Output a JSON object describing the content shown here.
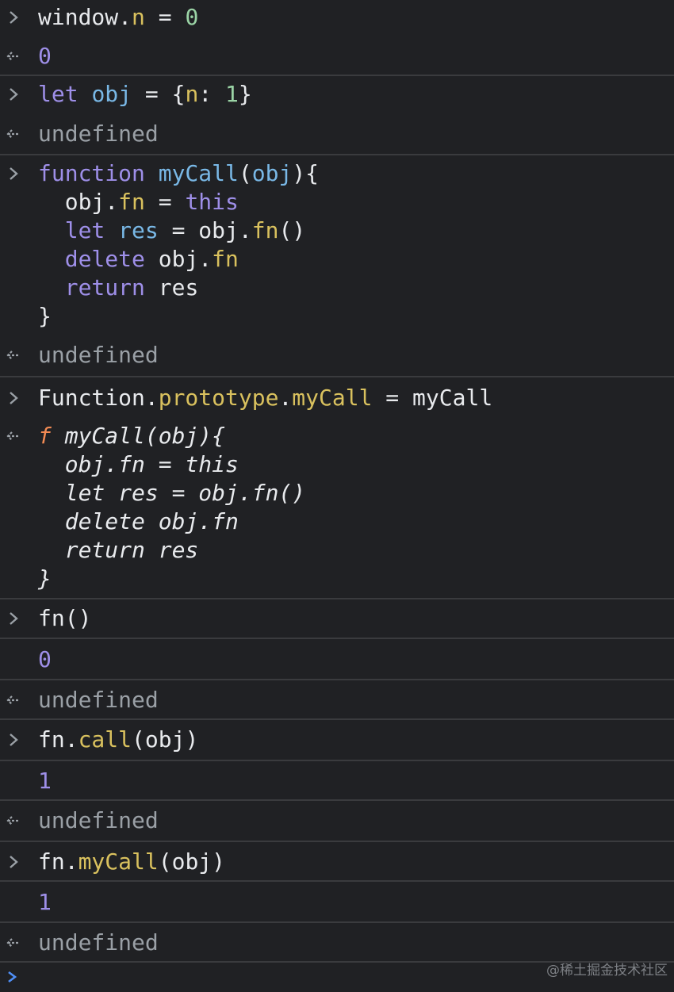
{
  "console": {
    "e1": {
      "input": [
        "window",
        ".",
        "n",
        " = ",
        "0"
      ],
      "output": "0"
    },
    "e2": {
      "input": [
        "let",
        " ",
        "obj",
        " = {",
        "n",
        ": ",
        "1",
        "}"
      ],
      "output": "undefined"
    },
    "e3": {
      "lines": [
        [
          "function",
          " ",
          "myCall",
          "(",
          "obj",
          "){"
        ],
        [
          "  obj.",
          "fn",
          " = ",
          "this"
        ],
        [
          "  ",
          "let",
          " ",
          "res",
          " = obj.",
          "fn",
          "()"
        ],
        [
          "  ",
          "delete",
          " obj.",
          "fn"
        ],
        [
          "  ",
          "return",
          " res"
        ],
        [
          "}"
        ]
      ],
      "output": "undefined"
    },
    "e4": {
      "input": [
        "Function",
        ".",
        "prototype",
        ".",
        "myCall",
        " = ",
        "myCall"
      ],
      "output_lines": [
        [
          "f",
          " myCall(obj){"
        ],
        [
          "  obj.fn = this"
        ],
        [
          "  let res = obj.fn()"
        ],
        [
          "  delete obj.fn"
        ],
        [
          "  return res"
        ],
        [
          "}"
        ]
      ]
    },
    "e5": {
      "input": [
        "fn()"
      ],
      "log": "0",
      "output": "undefined"
    },
    "e6": {
      "input": [
        "fn",
        ".",
        "call",
        "(obj)"
      ],
      "log": "1",
      "output": "undefined"
    },
    "e7": {
      "input": [
        "fn",
        ".",
        "myCall",
        "(obj)"
      ],
      "log": "1",
      "output": "undefined"
    }
  },
  "watermark": "@稀土掘金技术社区",
  "icons": {
    "input": "chevron-right-icon",
    "result": "return-arrow-icon",
    "prompt": "prompt-caret-icon"
  },
  "colors": {
    "background": "#202124",
    "keyword": "#9e8fe8",
    "property": "#d9c15e",
    "number": "#9bd4a6",
    "muted": "#9aa0a6"
  }
}
